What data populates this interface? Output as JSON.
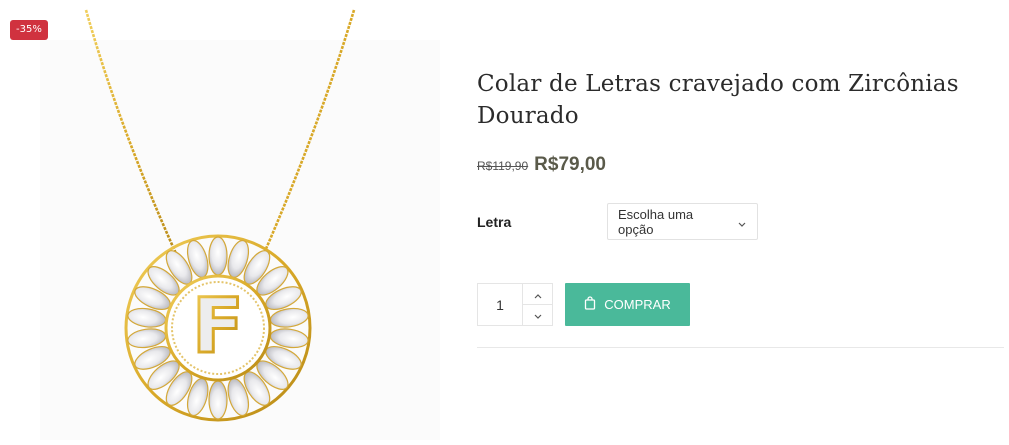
{
  "product": {
    "title": "Colar de Letras cravejado com Zircônias Dourado",
    "sale_badge": "-35%",
    "price_old": "R$119,90",
    "price_new": "R$79,00",
    "variation": {
      "label": "Letra",
      "selected": "Escolha uma opção"
    },
    "quantity": "1",
    "buy_label": "COMPRAR"
  },
  "image": {
    "letter": "F"
  },
  "icons": {
    "select_arrow": "chevron-down-icon",
    "qty_up": "chevron-up-icon",
    "qty_down": "chevron-down-icon",
    "buy": "shopping-bag-icon"
  },
  "colors": {
    "sale_badge": "#d0323f",
    "buy_button": "#4ab99a",
    "price_new": "#5a5a4a",
    "gold": "#d9a928"
  }
}
